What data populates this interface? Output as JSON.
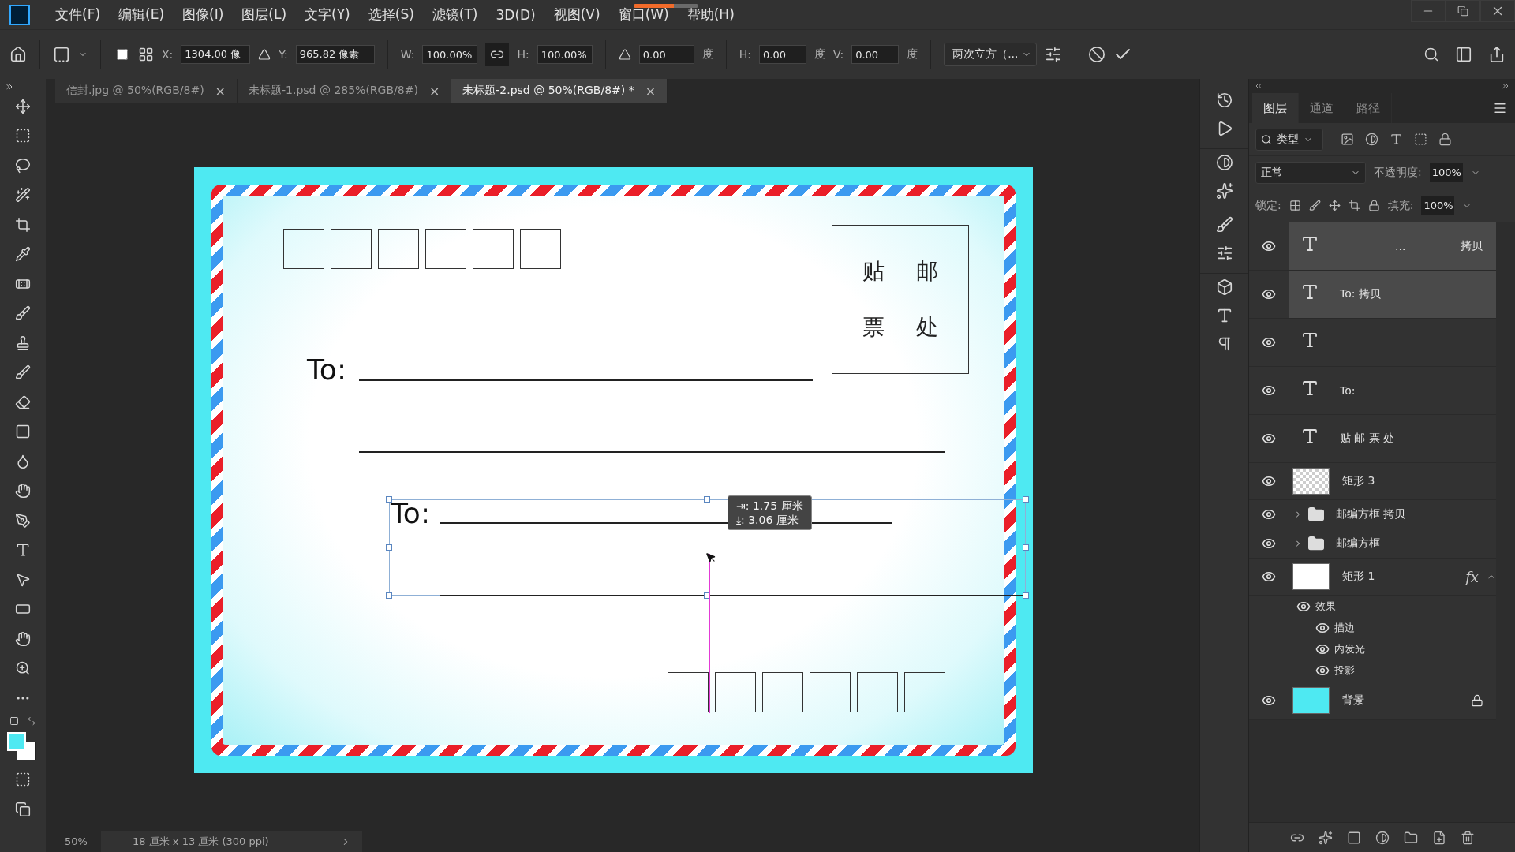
{
  "menu": [
    "文件(F)",
    "编辑(E)",
    "图像(I)",
    "图层(L)",
    "文字(Y)",
    "选择(S)",
    "滤镜(T)",
    "3D(D)",
    "视图(V)",
    "窗口(W)",
    "帮助(H)"
  ],
  "loading": {
    "level": 0.62
  },
  "options_bar": {
    "reference_checked": false,
    "x": {
      "label": "X:",
      "value": "1304.00 像"
    },
    "y": {
      "label": "Y:",
      "value": "965.82 像素"
    },
    "w": {
      "label": "W:",
      "value": "100.00%"
    },
    "link_on": true,
    "h": {
      "label": "H:",
      "value": "100.00%"
    },
    "rotate": {
      "value": "0.00",
      "unit": "度"
    },
    "skew_h": {
      "label": "H:",
      "value": "0.00",
      "unit": "度"
    },
    "skew_v": {
      "label": "V:",
      "value": "0.00",
      "unit": "度"
    },
    "interpolation": "两次立方（..."
  },
  "doc_tabs": [
    {
      "title": "信封.jpg @ 50%(RGB/8#)",
      "close": "×",
      "selected": false
    },
    {
      "title": "未标题-1.psd @ 285%(RGB/8#)",
      "close": "×",
      "selected": false
    },
    {
      "title": "未标题-2.psd @ 50%(RGB/8#) *",
      "close": "×",
      "selected": true
    }
  ],
  "canvas": {
    "stamp_chars": [
      "贴",
      "邮",
      "票",
      "处"
    ],
    "address_label": "To:",
    "copy_label": "To:",
    "measure": [
      "⇥: 1.75 厘米",
      "⤓: 3.06 厘米"
    ]
  },
  "layers_panel": {
    "tabs": [
      {
        "label": "图层",
        "selected": true
      },
      {
        "label": "通道",
        "selected": false
      },
      {
        "label": "路径",
        "selected": false
      }
    ],
    "filter": "类型",
    "blend_mode": "正常",
    "opacity_label": "不透明度:",
    "opacity": "100%",
    "lock_label": "锁定:",
    "fill_label": "填充:",
    "fill": "100%",
    "layers": [
      {
        "kind": "text",
        "name": "...",
        "suffix": "拷贝",
        "visible": true,
        "selected": true
      },
      {
        "kind": "text",
        "name": "To: 拷贝",
        "visible": true,
        "selected": true
      },
      {
        "kind": "text",
        "visible": true,
        "selected": false
      },
      {
        "kind": "text",
        "name": "To:",
        "visible": true,
        "selected": false
      },
      {
        "kind": "text",
        "name": "贴 邮 票 处",
        "visible": true,
        "selected": false
      },
      {
        "kind": "shape",
        "transparent_thumb": true,
        "name": "矩形 3",
        "visible": true,
        "selected": false
      },
      {
        "kind": "group",
        "name": "邮编方框 拷贝",
        "visible": true,
        "selected": false,
        "expanded": false
      },
      {
        "kind": "group",
        "name": "邮编方框",
        "visible": true,
        "selected": false,
        "expanded": false
      },
      {
        "kind": "shape",
        "transparent_thumb": false,
        "name": "矩形 1",
        "visible": true,
        "selected": false,
        "fx": "fx",
        "effects_label": "效果",
        "effects": [
          {
            "name": "描边",
            "visible": true
          },
          {
            "name": "内发光",
            "visible": true
          },
          {
            "name": "投影",
            "visible": true
          }
        ]
      },
      {
        "kind": "background",
        "name": "背景",
        "visible": true,
        "selected": false,
        "locked": true
      }
    ]
  },
  "status_bar": {
    "zoom": "50%",
    "doc_info": "18 厘米 x 13 厘米 (300 ppi)"
  }
}
